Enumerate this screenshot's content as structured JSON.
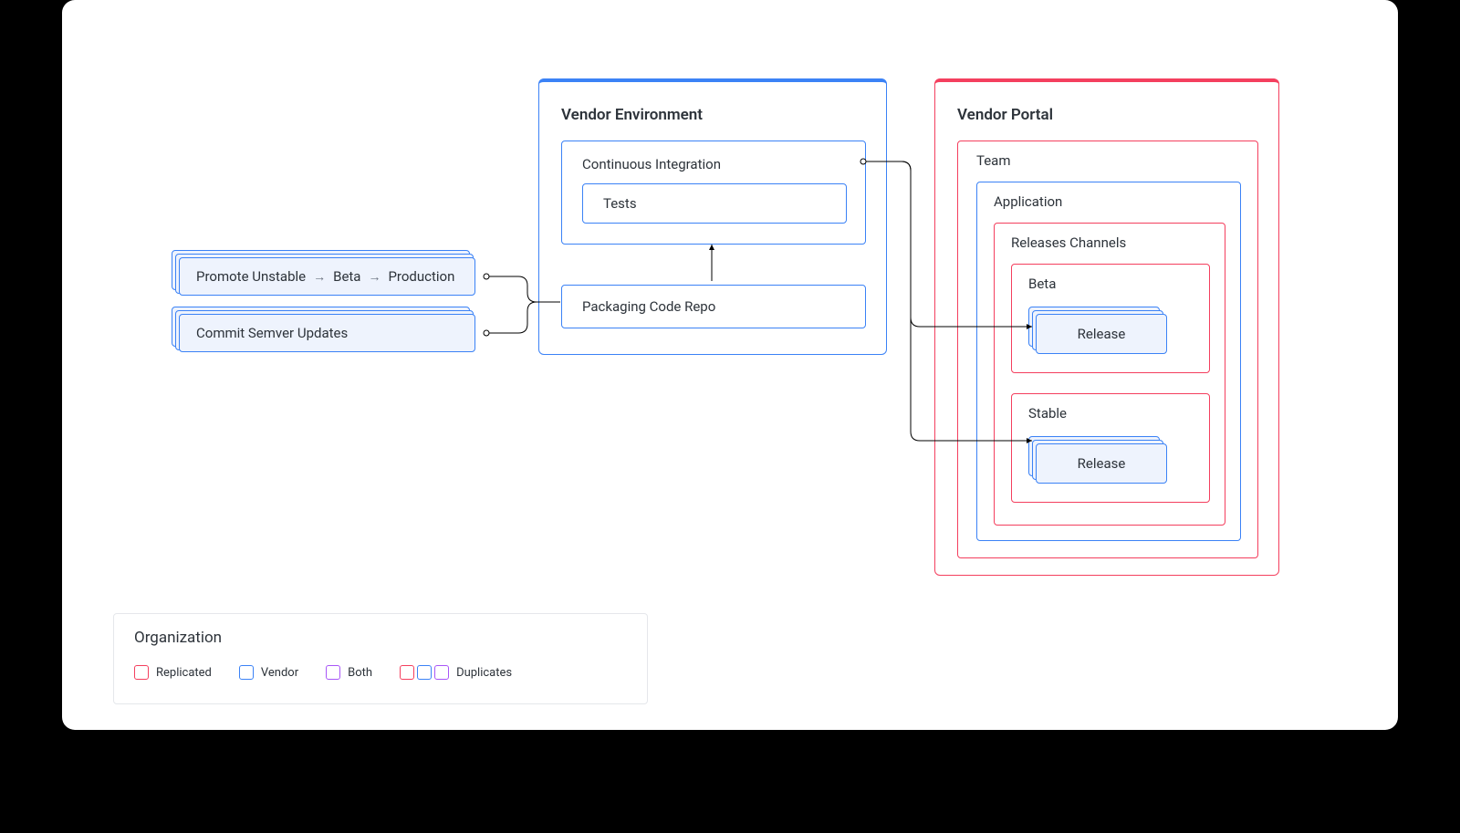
{
  "vendor_env": {
    "title": "Vendor Environment",
    "ci_title": "Continuous Integration",
    "tests_label": "Tests",
    "repo_label": "Packaging Code Repo"
  },
  "left_cards": {
    "promote": {
      "parts": [
        "Promote Unstable",
        "Beta",
        "Production"
      ]
    },
    "commit_label": "Commit Semver Updates"
  },
  "vendor_portal": {
    "title": "Vendor Portal",
    "team_label": "Team",
    "application_label": "Application",
    "releases_channels_label": "Releases Channels",
    "channels": [
      {
        "name": "Beta",
        "release_label": "Release"
      },
      {
        "name": "Stable",
        "release_label": "Release"
      }
    ]
  },
  "legend": {
    "title": "Organization",
    "items": [
      {
        "label": "Replicated",
        "color": "red"
      },
      {
        "label": "Vendor",
        "color": "blue"
      },
      {
        "label": "Both",
        "color": "purple"
      },
      {
        "label": "Duplicates",
        "color": "duplicates"
      }
    ]
  }
}
